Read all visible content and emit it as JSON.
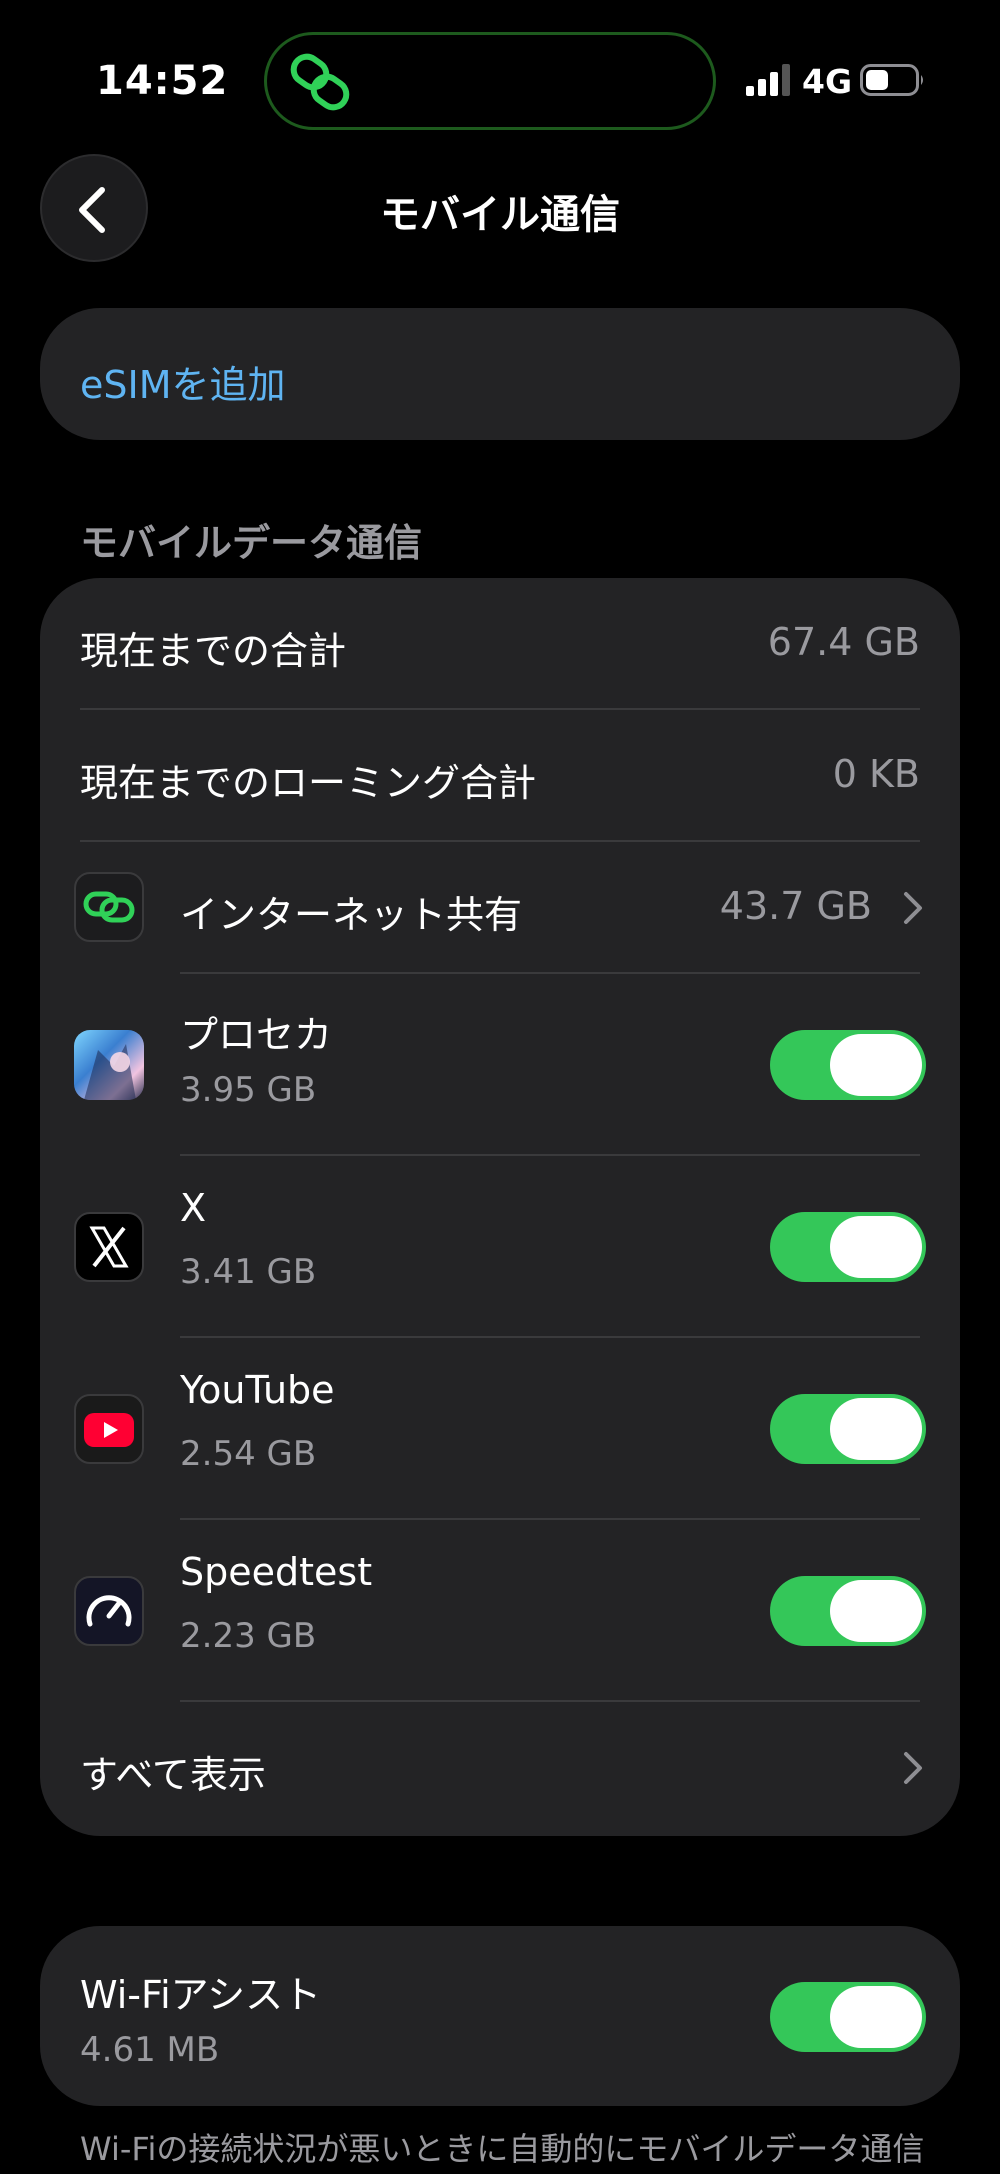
{
  "status_bar": {
    "time": "14:52",
    "network": "4G",
    "icons": [
      "hotspot-link-icon",
      "signal-bars-icon",
      "battery-icon"
    ]
  },
  "nav": {
    "title": "モバイル通信",
    "back_icon": "chevron-left-icon"
  },
  "esim": {
    "label": "eSIMを追加"
  },
  "mobile_data": {
    "section_title": "モバイルデータ通信",
    "current_total_label": "現在までの合計",
    "current_total_value": "67.4 GB",
    "roaming_total_label": "現在までのローミング合計",
    "roaming_total_value": "0 KB",
    "hotspot_label": "インターネット共有",
    "hotspot_value": "43.7 GB",
    "apps": [
      {
        "name": "プロセカ",
        "usage": "3.95 GB",
        "enabled": true,
        "icon": "prosekai-app-icon"
      },
      {
        "name": "X",
        "usage": "3.41 GB",
        "enabled": true,
        "icon": "x-app-icon"
      },
      {
        "name": "YouTube",
        "usage": "2.54 GB",
        "enabled": true,
        "icon": "youtube-app-icon"
      },
      {
        "name": "Speedtest",
        "usage": "2.23 GB",
        "enabled": true,
        "icon": "speedtest-app-icon"
      }
    ],
    "show_all_label": "すべて表示"
  },
  "wifi_assist": {
    "label": "Wi-Fiアシスト",
    "usage": "4.61 MB",
    "enabled": true,
    "footer": "Wi-Fiの接続状況が悪いときに自動的にモバイルデータ通信を使用します。"
  },
  "colors": {
    "accent_blue": "#5fb4f2",
    "toggle_on": "#34c759",
    "card_bg": "#232325",
    "secondary_text": "#9a9a9f",
    "hotspot_green": "#30d158"
  }
}
